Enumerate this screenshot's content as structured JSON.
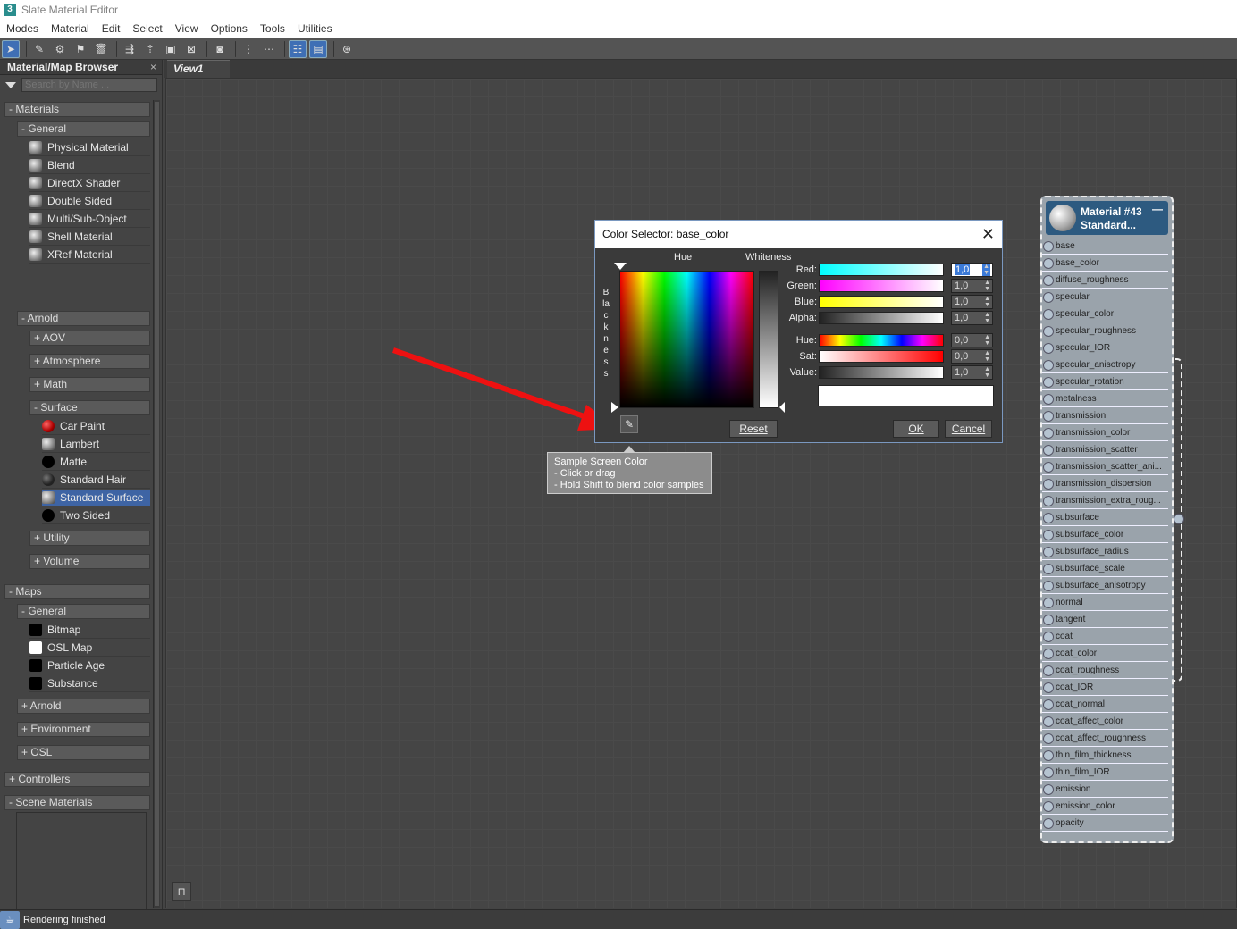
{
  "window": {
    "title": "Slate Material Editor",
    "app_icon": "3"
  },
  "menu": [
    "Modes",
    "Material",
    "Edit",
    "Select",
    "View",
    "Options",
    "Tools",
    "Utilities"
  ],
  "browser": {
    "title": "Material/Map Browser",
    "close": "×",
    "search_placeholder": "Search by Name ...",
    "materials": "- Materials",
    "general": "- General",
    "general_items": [
      "Physical Material",
      "Blend",
      "DirectX Shader",
      "Double Sided",
      "Multi/Sub-Object",
      "Shell Material",
      "XRef Material"
    ],
    "arnold": "- Arnold",
    "aov": "+ AOV",
    "atmosphere": "+ Atmosphere",
    "math": "+ Math",
    "surface": "- Surface",
    "surface_items": [
      "Car Paint",
      "Lambert",
      "Matte",
      "Standard Hair",
      "Standard Surface",
      "Two Sided"
    ],
    "utility": "+ Utility",
    "volume": "+ Volume",
    "maps": "- Maps",
    "maps_general": "- General",
    "maps_items": [
      "Bitmap",
      "OSL Map",
      "Particle Age",
      "Substance"
    ],
    "maps_arnold": "+ Arnold",
    "environment": "+ Environment",
    "osl": "+ OSL",
    "controllers": "+ Controllers",
    "scene_materials": "- Scene Materials"
  },
  "view": {
    "tab": "View1"
  },
  "status": {
    "text": "Rendering finished"
  },
  "node": {
    "title1": "Material #43",
    "title2": "Standard...",
    "minimize": "—",
    "slots": [
      "base",
      "base_color",
      "diffuse_roughness",
      "specular",
      "specular_color",
      "specular_roughness",
      "specular_IOR",
      "specular_anisotropy",
      "specular_rotation",
      "metalness",
      "transmission",
      "transmission_color",
      "transmission_scatter",
      "transmission_scatter_ani...",
      "transmission_dispersion",
      "transmission_extra_roug...",
      "subsurface",
      "subsurface_color",
      "subsurface_radius",
      "subsurface_scale",
      "subsurface_anisotropy",
      "normal",
      "tangent",
      "coat",
      "coat_color",
      "coat_roughness",
      "coat_IOR",
      "coat_normal",
      "coat_affect_color",
      "coat_affect_roughness",
      "thin_film_thickness",
      "thin_film_IOR",
      "emission",
      "emission_color",
      "opacity"
    ]
  },
  "dialog": {
    "title": "Color Selector: base_color",
    "close": "✕",
    "hue_label": "Hue",
    "whiteness_label": "Whiteness",
    "blackness_label": "Blackness",
    "red_label": "Red:",
    "red_value": "1,0",
    "green_label": "Green:",
    "green_value": "1,0",
    "blue_label": "Blue:",
    "blue_value": "1,0",
    "alpha_label": "Alpha:",
    "alpha_value": "1,0",
    "hue2_label": "Hue:",
    "hue2_value": "0,0",
    "sat_label": "Sat:",
    "sat_value": "0,0",
    "value_label": "Value:",
    "value_value": "1,0",
    "reset": "Reset",
    "ok": "OK",
    "cancel": "Cancel",
    "current_color": "#ffffff"
  },
  "tooltip": {
    "line1": "Sample Screen Color",
    "line2": "- Click or drag",
    "line3": "- Hold Shift to blend color samples"
  },
  "colors": {
    "selection": "#3e64a4",
    "node_header": "#2d5a80",
    "annotation_arrow": "#ee1111"
  }
}
